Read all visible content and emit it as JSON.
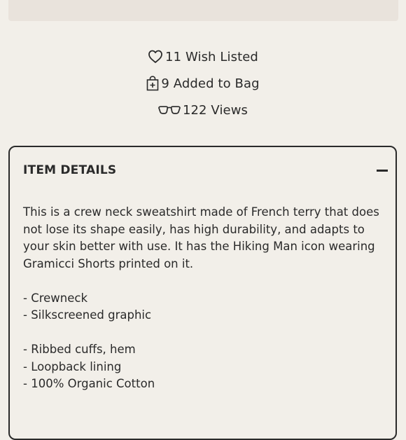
{
  "stats": {
    "wish_listed": "11 Wish Listed",
    "added_to_bag": "9 Added to Bag",
    "views": "122 Views"
  },
  "icons": {
    "wish": "heart-icon",
    "bag": "shopping-bag-icon",
    "views": "glasses-icon"
  },
  "details": {
    "title": "ITEM DETAILS",
    "toggle": "minus-icon",
    "description": "This is a crew neck sweatshirt made of French terry that does not lose its shape easily, has high durability, and adapts to your skin better with use. It has the Hiking Man icon wearing Gramicci Shorts printed on it.",
    "features_group_1": [
      "- Crewneck",
      "- Silkscreened graphic"
    ],
    "features_group_2": [
      "- Ribbed cuffs, hem",
      "- Loopback lining",
      "- 100% Organic Cotton"
    ]
  }
}
